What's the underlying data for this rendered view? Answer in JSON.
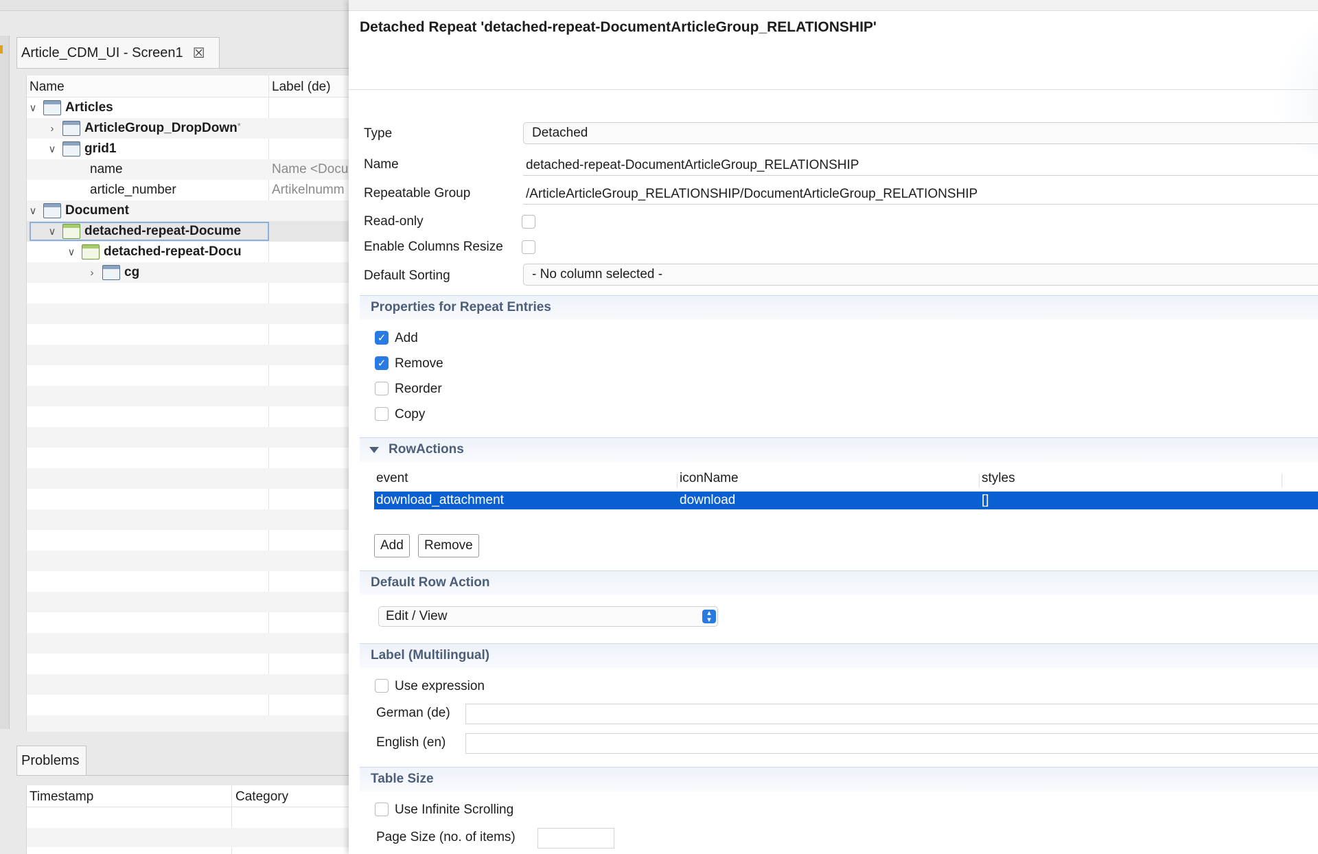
{
  "editor": {
    "tab_title": "Article_CDM_UI - Screen1",
    "tab_close_icon": "close-icon",
    "tree": {
      "columns": [
        "Name",
        "Label (de)"
      ],
      "nodes": [
        {
          "name": "Articles",
          "label": "",
          "chevron": "∨"
        },
        {
          "name": "ArticleGroup_DropDown",
          "modified": "*",
          "label": "",
          "chevron": "›"
        },
        {
          "name": "grid1",
          "label": "",
          "chevron": "∨"
        },
        {
          "name": "name",
          "label": "Name <Docu"
        },
        {
          "name": "article_number",
          "label": "Artikelnumm"
        },
        {
          "name": "Document",
          "label": "",
          "chevron": "∨"
        },
        {
          "name": "detached-repeat-Docume",
          "label": "",
          "chevron": "∨"
        },
        {
          "name": "detached-repeat-Docu",
          "label": "",
          "chevron": "∨"
        },
        {
          "name": "cg",
          "label": "",
          "chevron": "›"
        }
      ]
    }
  },
  "problems": {
    "tab_title": "Problems",
    "columns": [
      "Timestamp",
      "Category"
    ]
  },
  "panel": {
    "title": "Detached Repeat 'detached-repeat-DocumentArticleGroup_RELATIONSHIP'",
    "fields": {
      "type_label": "Type",
      "type_value": "Detached",
      "name_label": "Name",
      "name_value": "detached-repeat-DocumentArticleGroup_RELATIONSHIP",
      "group_label": "Repeatable Group",
      "group_value": "/ArticleArticleGroup_RELATIONSHIP/DocumentArticleGroup_RELATIONSHIP",
      "readonly_label": "Read-only",
      "readonly_checked": false,
      "resize_label": "Enable Columns Resize",
      "resize_checked": false,
      "sorting_label": "Default Sorting",
      "sorting_value": "- No column selected -"
    },
    "repeat_entries": {
      "heading": "Properties for Repeat Entries",
      "options": [
        {
          "label": "Add",
          "checked": true
        },
        {
          "label": "Remove",
          "checked": true
        },
        {
          "label": "Reorder",
          "checked": false
        },
        {
          "label": "Copy",
          "checked": false
        }
      ]
    },
    "row_actions": {
      "heading": "RowActions",
      "columns": [
        "event",
        "iconName",
        "styles"
      ],
      "rows": [
        {
          "event": "download_attachment",
          "iconName": "download",
          "styles": "[]"
        }
      ],
      "add_label": "Add",
      "remove_label": "Remove"
    },
    "default_row_action": {
      "heading": "Default Row Action",
      "value": "Edit / View"
    },
    "label_section": {
      "heading": "Label (Multilingual)",
      "use_expression_label": "Use expression",
      "use_expression_checked": false,
      "german_label": "German (de)",
      "german_value": "",
      "english_label": "English (en)",
      "english_value": ""
    },
    "table_size": {
      "heading": "Table Size",
      "infinite_label": "Use Infinite Scrolling",
      "infinite_checked": false,
      "page_size_label": "Page Size (no. of items)",
      "page_size_value": ""
    }
  },
  "colors": {
    "accent": "#2a7ae4",
    "selection": "#0b60d1",
    "section_text": "#4e5e78"
  }
}
